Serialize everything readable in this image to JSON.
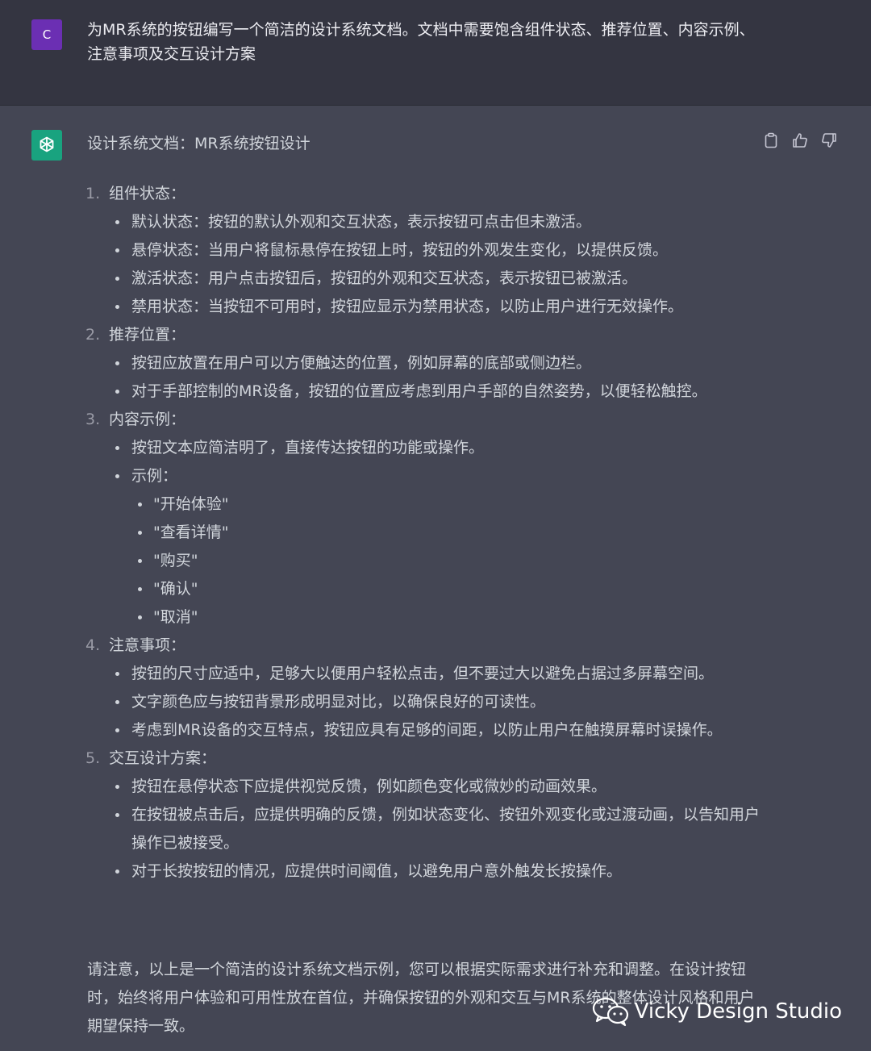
{
  "user": {
    "avatar_letter": "C",
    "message": "为MR系统的按钮编写一个简洁的设计系统文档。文档中需要饱含组件状态、推荐位置、内容示例、注意事项及交互设计方案"
  },
  "assistant": {
    "title": "设计系统文档：MR系统按钮设计",
    "sections": [
      {
        "num": "1.",
        "heading": "组件状态：",
        "items": [
          {
            "text": "默认状态：按钮的默认外观和交互状态，表示按钮可点击但未激活。"
          },
          {
            "text": "悬停状态：当用户将鼠标悬停在按钮上时，按钮的外观发生变化，以提供反馈。"
          },
          {
            "text": "激活状态：用户点击按钮后，按钮的外观和交互状态，表示按钮已被激活。"
          },
          {
            "text": "禁用状态：当按钮不可用时，按钮应显示为禁用状态，以防止用户进行无效操作。"
          }
        ]
      },
      {
        "num": "2.",
        "heading": "推荐位置：",
        "items": [
          {
            "text": "按钮应放置在用户可以方便触达的位置，例如屏幕的底部或侧边栏。"
          },
          {
            "text": "对于手部控制的MR设备，按钮的位置应考虑到用户手部的自然姿势，以便轻松触控。"
          }
        ]
      },
      {
        "num": "3.",
        "heading": "内容示例：",
        "items": [
          {
            "text": "按钮文本应简洁明了，直接传达按钮的功能或操作。"
          },
          {
            "text": "示例：",
            "sub": [
              "\"开始体验\"",
              "\"查看详情\"",
              "\"购买\"",
              "\"确认\"",
              "\"取消\""
            ]
          }
        ]
      },
      {
        "num": "4.",
        "heading": "注意事项：",
        "items": [
          {
            "text": "按钮的尺寸应适中，足够大以便用户轻松点击，但不要过大以避免占据过多屏幕空间。"
          },
          {
            "text": "文字颜色应与按钮背景形成明显对比，以确保良好的可读性。"
          },
          {
            "text": "考虑到MR设备的交互特点，按钮应具有足够的间距，以防止用户在触摸屏幕时误操作。"
          }
        ]
      },
      {
        "num": "5.",
        "heading": "交互设计方案：",
        "items": [
          {
            "text": "按钮在悬停状态下应提供视觉反馈，例如颜色变化或微妙的动画效果。"
          },
          {
            "text": "在按钮被点击后，应提供明确的反馈，例如状态变化、按钮外观变化或过渡动画，以告知用户操作已被接受。"
          },
          {
            "text": "对于长按按钮的情况，应提供时间阈值，以避免用户意外触发长按操作。"
          }
        ]
      }
    ],
    "conclusion": "请注意，以上是一个简洁的设计系统文档示例，您可以根据实际需求进行补充和调整。在设计按钮时，始终将用户体验和可用性放在首位，并确保按钮的外观和交互与MR系统的整体设计风格和用户期望保持一致。",
    "actions": [
      "clipboard-icon",
      "thumbs-up-icon",
      "thumbs-down-icon"
    ]
  },
  "watermark": {
    "text": "Vicky Design Studio",
    "icon": "wechat-icon"
  },
  "colors": {
    "user_bg": "#343541",
    "assistant_bg": "#444654",
    "user_avatar": "#6b2fb3",
    "bot_avatar": "#19a37f",
    "text": "#d1d5db"
  }
}
